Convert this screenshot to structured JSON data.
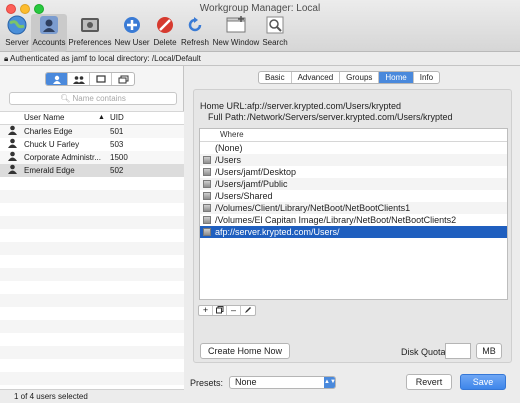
{
  "window": {
    "title": "Workgroup Manager: Local"
  },
  "toolbar": {
    "items": [
      {
        "label": "Server",
        "icon": "globe-icon"
      },
      {
        "label": "Accounts",
        "icon": "accounts-icon"
      },
      {
        "label": "Preferences",
        "icon": "preferences-icon"
      },
      {
        "label": "New User",
        "icon": "plus-icon"
      },
      {
        "label": "Delete",
        "icon": "delete-icon"
      },
      {
        "label": "Refresh",
        "icon": "refresh-icon"
      },
      {
        "label": "New Window",
        "icon": "new-window-icon"
      },
      {
        "label": "Search",
        "icon": "search-icon"
      }
    ],
    "selected": "Accounts"
  },
  "auth": {
    "text": "Authenticated as jamf to local directory: /Local/Default"
  },
  "sidebar": {
    "search_placeholder": "Name contains",
    "columns": {
      "name": "User Name",
      "uid": "UID"
    },
    "users": [
      {
        "name": "Charles Edge",
        "uid": "501"
      },
      {
        "name": "Chuck U Farley",
        "uid": "503"
      },
      {
        "name": "Corporate Administr...",
        "uid": "1500"
      },
      {
        "name": "Emerald Edge",
        "uid": "502"
      }
    ],
    "footer": "1 of 4 users selected"
  },
  "tabs": [
    "Basic",
    "Advanced",
    "Groups",
    "Home",
    "Info"
  ],
  "active_tab": "Home",
  "home": {
    "url_label": "Home URL:",
    "url_value": "afp://server.krypted.com/Users/krypted",
    "path_label": "Full Path:",
    "path_value": "/Network/Servers/server.krypted.com/Users/krypted",
    "column": "Where",
    "paths": [
      "(None)",
      "/Users",
      "/Users/jamf/Desktop",
      "/Users/jamf/Public",
      "/Users/Shared",
      "/Volumes/Client/Library/NetBoot/NetBootClients1",
      "/Volumes/El Capitan Image/Library/NetBoot/NetBootClients2",
      "afp://server.krypted.com/Users/"
    ],
    "create_button": "Create Home Now",
    "quota_label": "Disk Quota:",
    "quota_unit": "MB"
  },
  "footer": {
    "presets_label": "Presets:",
    "presets_value": "None",
    "revert": "Revert",
    "save": "Save"
  },
  "colors": {
    "accent": "#4a89dc",
    "selection": "#1f5fbf"
  }
}
